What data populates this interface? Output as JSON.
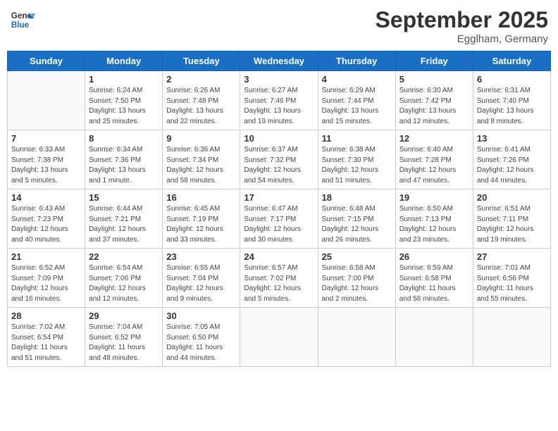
{
  "header": {
    "logo_line1": "General",
    "logo_line2": "Blue",
    "month": "September 2025",
    "location": "Egglham, Germany"
  },
  "weekdays": [
    "Sunday",
    "Monday",
    "Tuesday",
    "Wednesday",
    "Thursday",
    "Friday",
    "Saturday"
  ],
  "weeks": [
    [
      {
        "day": "",
        "info": ""
      },
      {
        "day": "1",
        "info": "Sunrise: 6:24 AM\nSunset: 7:50 PM\nDaylight: 13 hours\nand 25 minutes."
      },
      {
        "day": "2",
        "info": "Sunrise: 6:26 AM\nSunset: 7:48 PM\nDaylight: 13 hours\nand 22 minutes."
      },
      {
        "day": "3",
        "info": "Sunrise: 6:27 AM\nSunset: 7:46 PM\nDaylight: 13 hours\nand 19 minutes."
      },
      {
        "day": "4",
        "info": "Sunrise: 6:29 AM\nSunset: 7:44 PM\nDaylight: 13 hours\nand 15 minutes."
      },
      {
        "day": "5",
        "info": "Sunrise: 6:30 AM\nSunset: 7:42 PM\nDaylight: 13 hours\nand 12 minutes."
      },
      {
        "day": "6",
        "info": "Sunrise: 6:31 AM\nSunset: 7:40 PM\nDaylight: 13 hours\nand 8 minutes."
      }
    ],
    [
      {
        "day": "7",
        "info": "Sunrise: 6:33 AM\nSunset: 7:38 PM\nDaylight: 13 hours\nand 5 minutes."
      },
      {
        "day": "8",
        "info": "Sunrise: 6:34 AM\nSunset: 7:36 PM\nDaylight: 13 hours\nand 1 minute."
      },
      {
        "day": "9",
        "info": "Sunrise: 6:36 AM\nSunset: 7:34 PM\nDaylight: 12 hours\nand 58 minutes."
      },
      {
        "day": "10",
        "info": "Sunrise: 6:37 AM\nSunset: 7:32 PM\nDaylight: 12 hours\nand 54 minutes."
      },
      {
        "day": "11",
        "info": "Sunrise: 6:38 AM\nSunset: 7:30 PM\nDaylight: 12 hours\nand 51 minutes."
      },
      {
        "day": "12",
        "info": "Sunrise: 6:40 AM\nSunset: 7:28 PM\nDaylight: 12 hours\nand 47 minutes."
      },
      {
        "day": "13",
        "info": "Sunrise: 6:41 AM\nSunset: 7:26 PM\nDaylight: 12 hours\nand 44 minutes."
      }
    ],
    [
      {
        "day": "14",
        "info": "Sunrise: 6:43 AM\nSunset: 7:23 PM\nDaylight: 12 hours\nand 40 minutes."
      },
      {
        "day": "15",
        "info": "Sunrise: 6:44 AM\nSunset: 7:21 PM\nDaylight: 12 hours\nand 37 minutes."
      },
      {
        "day": "16",
        "info": "Sunrise: 6:45 AM\nSunset: 7:19 PM\nDaylight: 12 hours\nand 33 minutes."
      },
      {
        "day": "17",
        "info": "Sunrise: 6:47 AM\nSunset: 7:17 PM\nDaylight: 12 hours\nand 30 minutes."
      },
      {
        "day": "18",
        "info": "Sunrise: 6:48 AM\nSunset: 7:15 PM\nDaylight: 12 hours\nand 26 minutes."
      },
      {
        "day": "19",
        "info": "Sunrise: 6:50 AM\nSunset: 7:13 PM\nDaylight: 12 hours\nand 23 minutes."
      },
      {
        "day": "20",
        "info": "Sunrise: 6:51 AM\nSunset: 7:11 PM\nDaylight: 12 hours\nand 19 minutes."
      }
    ],
    [
      {
        "day": "21",
        "info": "Sunrise: 6:52 AM\nSunset: 7:09 PM\nDaylight: 12 hours\nand 16 minutes."
      },
      {
        "day": "22",
        "info": "Sunrise: 6:54 AM\nSunset: 7:06 PM\nDaylight: 12 hours\nand 12 minutes."
      },
      {
        "day": "23",
        "info": "Sunrise: 6:55 AM\nSunset: 7:04 PM\nDaylight: 12 hours\nand 9 minutes."
      },
      {
        "day": "24",
        "info": "Sunrise: 6:57 AM\nSunset: 7:02 PM\nDaylight: 12 hours\nand 5 minutes."
      },
      {
        "day": "25",
        "info": "Sunrise: 6:58 AM\nSunset: 7:00 PM\nDaylight: 12 hours\nand 2 minutes."
      },
      {
        "day": "26",
        "info": "Sunrise: 6:59 AM\nSunset: 6:58 PM\nDaylight: 11 hours\nand 58 minutes."
      },
      {
        "day": "27",
        "info": "Sunrise: 7:01 AM\nSunset: 6:56 PM\nDaylight: 11 hours\nand 55 minutes."
      }
    ],
    [
      {
        "day": "28",
        "info": "Sunrise: 7:02 AM\nSunset: 6:54 PM\nDaylight: 11 hours\nand 51 minutes."
      },
      {
        "day": "29",
        "info": "Sunrise: 7:04 AM\nSunset: 6:52 PM\nDaylight: 11 hours\nand 48 minutes."
      },
      {
        "day": "30",
        "info": "Sunrise: 7:05 AM\nSunset: 6:50 PM\nDaylight: 11 hours\nand 44 minutes."
      },
      {
        "day": "",
        "info": ""
      },
      {
        "day": "",
        "info": ""
      },
      {
        "day": "",
        "info": ""
      },
      {
        "day": "",
        "info": ""
      }
    ]
  ]
}
